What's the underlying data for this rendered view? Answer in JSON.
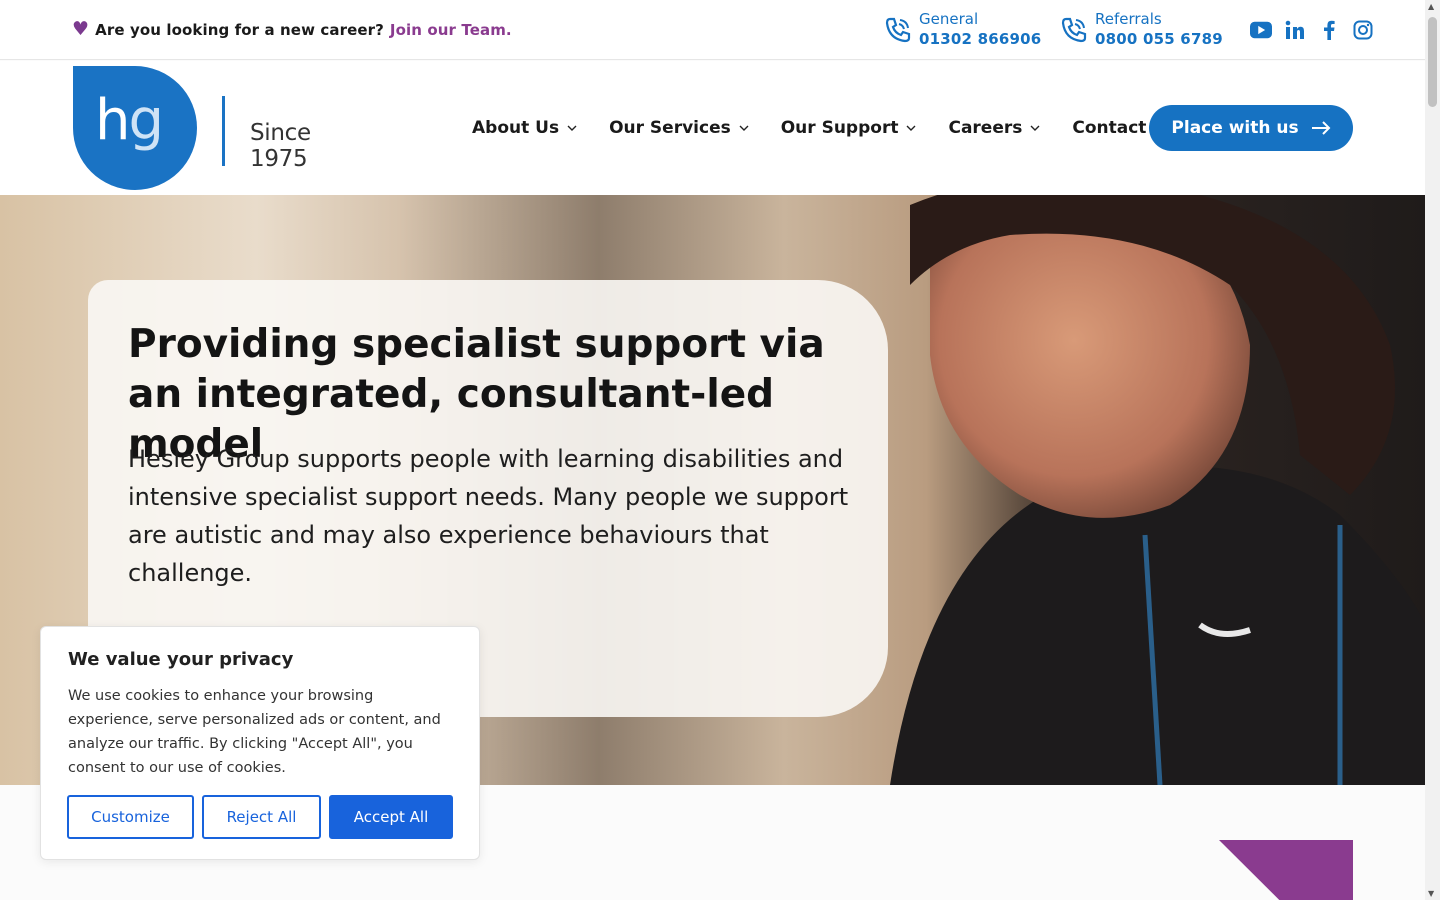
{
  "topbar": {
    "career_text": "Are you looking for a new career?",
    "career_link": "Join our Team.",
    "phones": [
      {
        "label": "General",
        "number": "01302 866906"
      },
      {
        "label": "Referrals",
        "number": "0800 055 6789"
      }
    ],
    "social_icons": [
      "youtube-icon",
      "linkedin-icon",
      "facebook-icon",
      "instagram-icon"
    ]
  },
  "header": {
    "logo_text": "hg",
    "logo_since": "Since 1975",
    "nav": [
      {
        "label": "About Us",
        "dropdown": true
      },
      {
        "label": "Our Services",
        "dropdown": true
      },
      {
        "label": "Our Support",
        "dropdown": true
      },
      {
        "label": "Careers",
        "dropdown": true
      },
      {
        "label": "Contact Us",
        "dropdown": false
      }
    ],
    "cta_label": "Place with us"
  },
  "hero": {
    "title": "Providing specialist support via an integrated, consultant-led model",
    "text": "Hesley Group supports people with learning disabilities and intensive specialist support needs. Many people we support are autistic and may also experience behaviours that challenge."
  },
  "cookie": {
    "title": "We value your privacy",
    "text": "We use cookies to enhance your browsing experience, serve personalized ads or content, and analyze our traffic. By clicking \"Accept All\", you consent to our use of cookies.",
    "customize": "Customize",
    "reject": "Reject All",
    "accept": "Accept All"
  },
  "colors": {
    "brand_blue": "#1672c2",
    "brand_purple": "#8a3b8f",
    "cookie_blue": "#1863dc"
  }
}
